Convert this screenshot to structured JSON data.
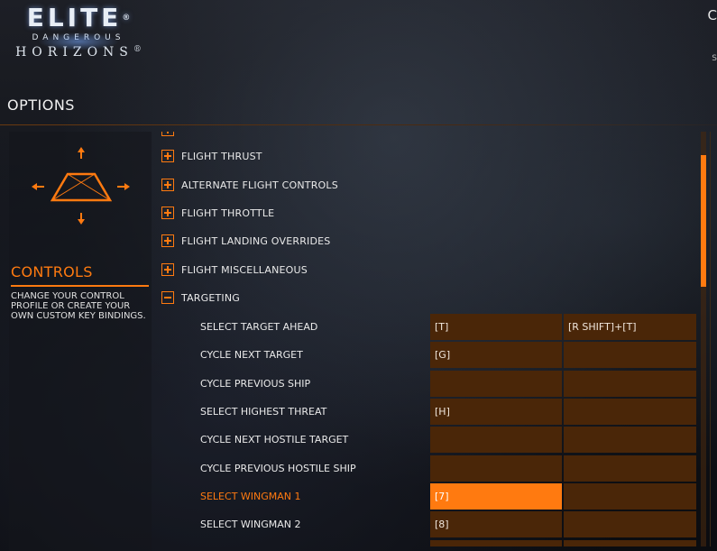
{
  "logo": {
    "elite": "ELITE",
    "reg": "®",
    "dangerous": "DANGEROUS",
    "horizons": "HORIZONS",
    "tm": "®"
  },
  "header": {
    "corner_text": "C",
    "corner_sub": "S"
  },
  "options": {
    "title": "OPTIONS"
  },
  "controls": {
    "title": "CONTROLS",
    "description": "CHANGE YOUR CONTROL PROFILE OR CREATE YOUR OWN CUSTOM KEY BINDINGS."
  },
  "categories": [
    {
      "label": "FLIGHT THRUST",
      "expanded": false
    },
    {
      "label": "ALTERNATE FLIGHT CONTROLS",
      "expanded": false
    },
    {
      "label": "FLIGHT THROTTLE",
      "expanded": false
    },
    {
      "label": "FLIGHT LANDING OVERRIDES",
      "expanded": false
    },
    {
      "label": "FLIGHT MISCELLANEOUS",
      "expanded": false
    },
    {
      "label": "TARGETING",
      "expanded": true
    }
  ],
  "bindings": [
    {
      "label": "SELECT TARGET AHEAD",
      "primary": "[T]",
      "secondary": "[R SHIFT]+[T]"
    },
    {
      "label": "CYCLE NEXT TARGET",
      "primary": "[G]",
      "secondary": ""
    },
    {
      "label": "CYCLE PREVIOUS SHIP",
      "primary": "",
      "secondary": ""
    },
    {
      "label": "SELECT HIGHEST THREAT",
      "primary": "[H]",
      "secondary": ""
    },
    {
      "label": "CYCLE NEXT HOSTILE TARGET",
      "primary": "",
      "secondary": ""
    },
    {
      "label": "CYCLE PREVIOUS HOSTILE SHIP",
      "primary": "",
      "secondary": ""
    },
    {
      "label": "SELECT WINGMAN 1",
      "primary": "[7]",
      "secondary": "",
      "active": true
    },
    {
      "label": "SELECT WINGMAN 2",
      "primary": "[8]",
      "secondary": ""
    }
  ],
  "colors": {
    "accent": "#ff7a10",
    "key_bg": "#4a2608"
  },
  "icons": {
    "expand": "plus-box-icon",
    "collapse": "minus-box-icon",
    "ship": "ship-controls-icon"
  }
}
